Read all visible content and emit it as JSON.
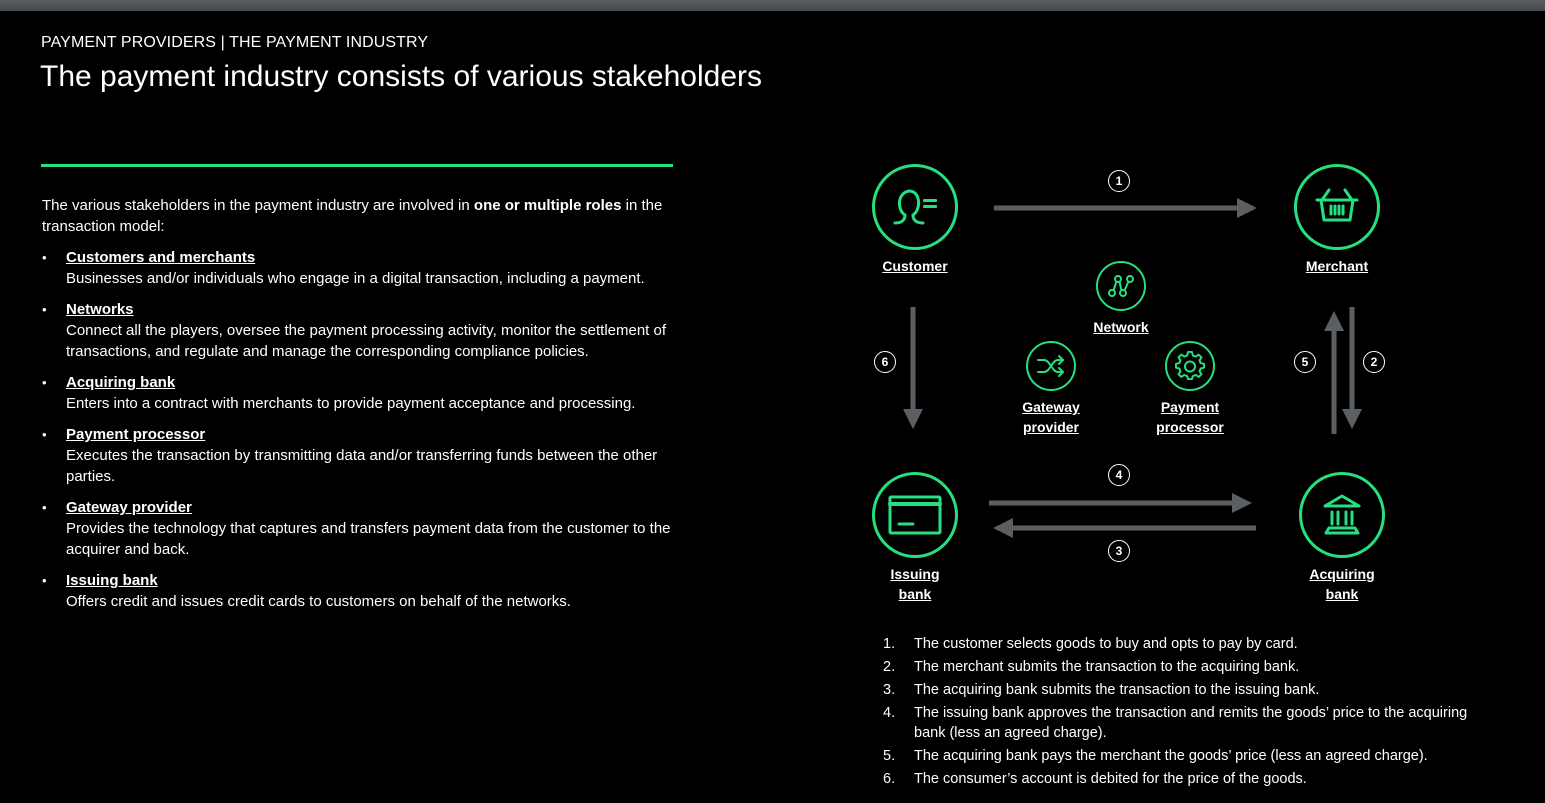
{
  "colors": {
    "accent": "#26e07f",
    "arrow": "#5b5f63",
    "background": "#000000",
    "topbar": "#505357"
  },
  "header": {
    "kicker": "PAYMENT PROVIDERS | THE PAYMENT INDUSTRY",
    "title": "The payment industry consists of various stakeholders"
  },
  "intro": {
    "text_before": "The various stakeholders in the payment industry are involved in ",
    "bold": "one or multiple roles",
    "text_after": " in the transaction model:"
  },
  "roles": [
    {
      "name": "Customers and merchants",
      "description": "Businesses and/or individuals who engage in a digital transaction, including a payment."
    },
    {
      "name": "Networks",
      "description": "Connect all the players, oversee the payment processing activity, monitor the settlement of transactions, and regulate and manage the corresponding compliance policies."
    },
    {
      "name": "Acquiring bank",
      "description": "Enters into a contract with merchants to provide payment acceptance and processing."
    },
    {
      "name": "Payment processor",
      "description": "Executes the transaction by transmitting data and/or transferring funds between the other parties."
    },
    {
      "name": "Gateway provider",
      "description": "Provides the technology that captures and transfers payment data from the customer to the acquirer and back."
    },
    {
      "name": "Issuing bank",
      "description": "Offers credit and issues credit cards to customers on behalf of the networks."
    }
  ],
  "bullet": "•",
  "diagram": {
    "nodes": {
      "customer": {
        "label": "Customer",
        "icon": "person-icon"
      },
      "merchant": {
        "label": "Merchant",
        "icon": "basket-icon"
      },
      "network": {
        "label": "Network",
        "icon": "network-graph-icon"
      },
      "gateway": {
        "label": "Gateway\nprovider",
        "icon": "shuffle-icon"
      },
      "processor": {
        "label": "Payment\nprocessor",
        "icon": "gear-icon"
      },
      "issuing": {
        "label": "Issuing\nbank",
        "icon": "credit-card-icon"
      },
      "acquiring": {
        "label": "Acquiring\nbank",
        "icon": "bank-building-icon"
      }
    },
    "flows": [
      {
        "step": "1",
        "from": "Customer",
        "to": "Merchant"
      },
      {
        "step": "2",
        "from": "Merchant",
        "to": "Acquiring bank"
      },
      {
        "step": "3",
        "from": "Acquiring bank",
        "to": "Issuing bank"
      },
      {
        "step": "4",
        "from": "Issuing bank",
        "to": "Acquiring bank"
      },
      {
        "step": "5",
        "from": "Acquiring bank",
        "to": "Merchant"
      },
      {
        "step": "6",
        "from": "Customer",
        "to": "Issuing bank"
      }
    ]
  },
  "steps": [
    {
      "num": "1.",
      "text": "The customer selects goods to buy and opts to pay by card."
    },
    {
      "num": "2.",
      "text": "The merchant submits the transaction to the acquiring bank."
    },
    {
      "num": "3.",
      "text": "The acquiring bank submits the transaction to the issuing bank."
    },
    {
      "num": "4.",
      "text": "The issuing bank approves the transaction and remits the goods’ price to the acquiring bank (less an agreed charge)."
    },
    {
      "num": "5.",
      "text": "The acquiring bank pays the merchant the goods’ price (less an agreed charge)."
    },
    {
      "num": "6.",
      "text": "The consumer’s account is debited for the price of the goods."
    }
  ]
}
